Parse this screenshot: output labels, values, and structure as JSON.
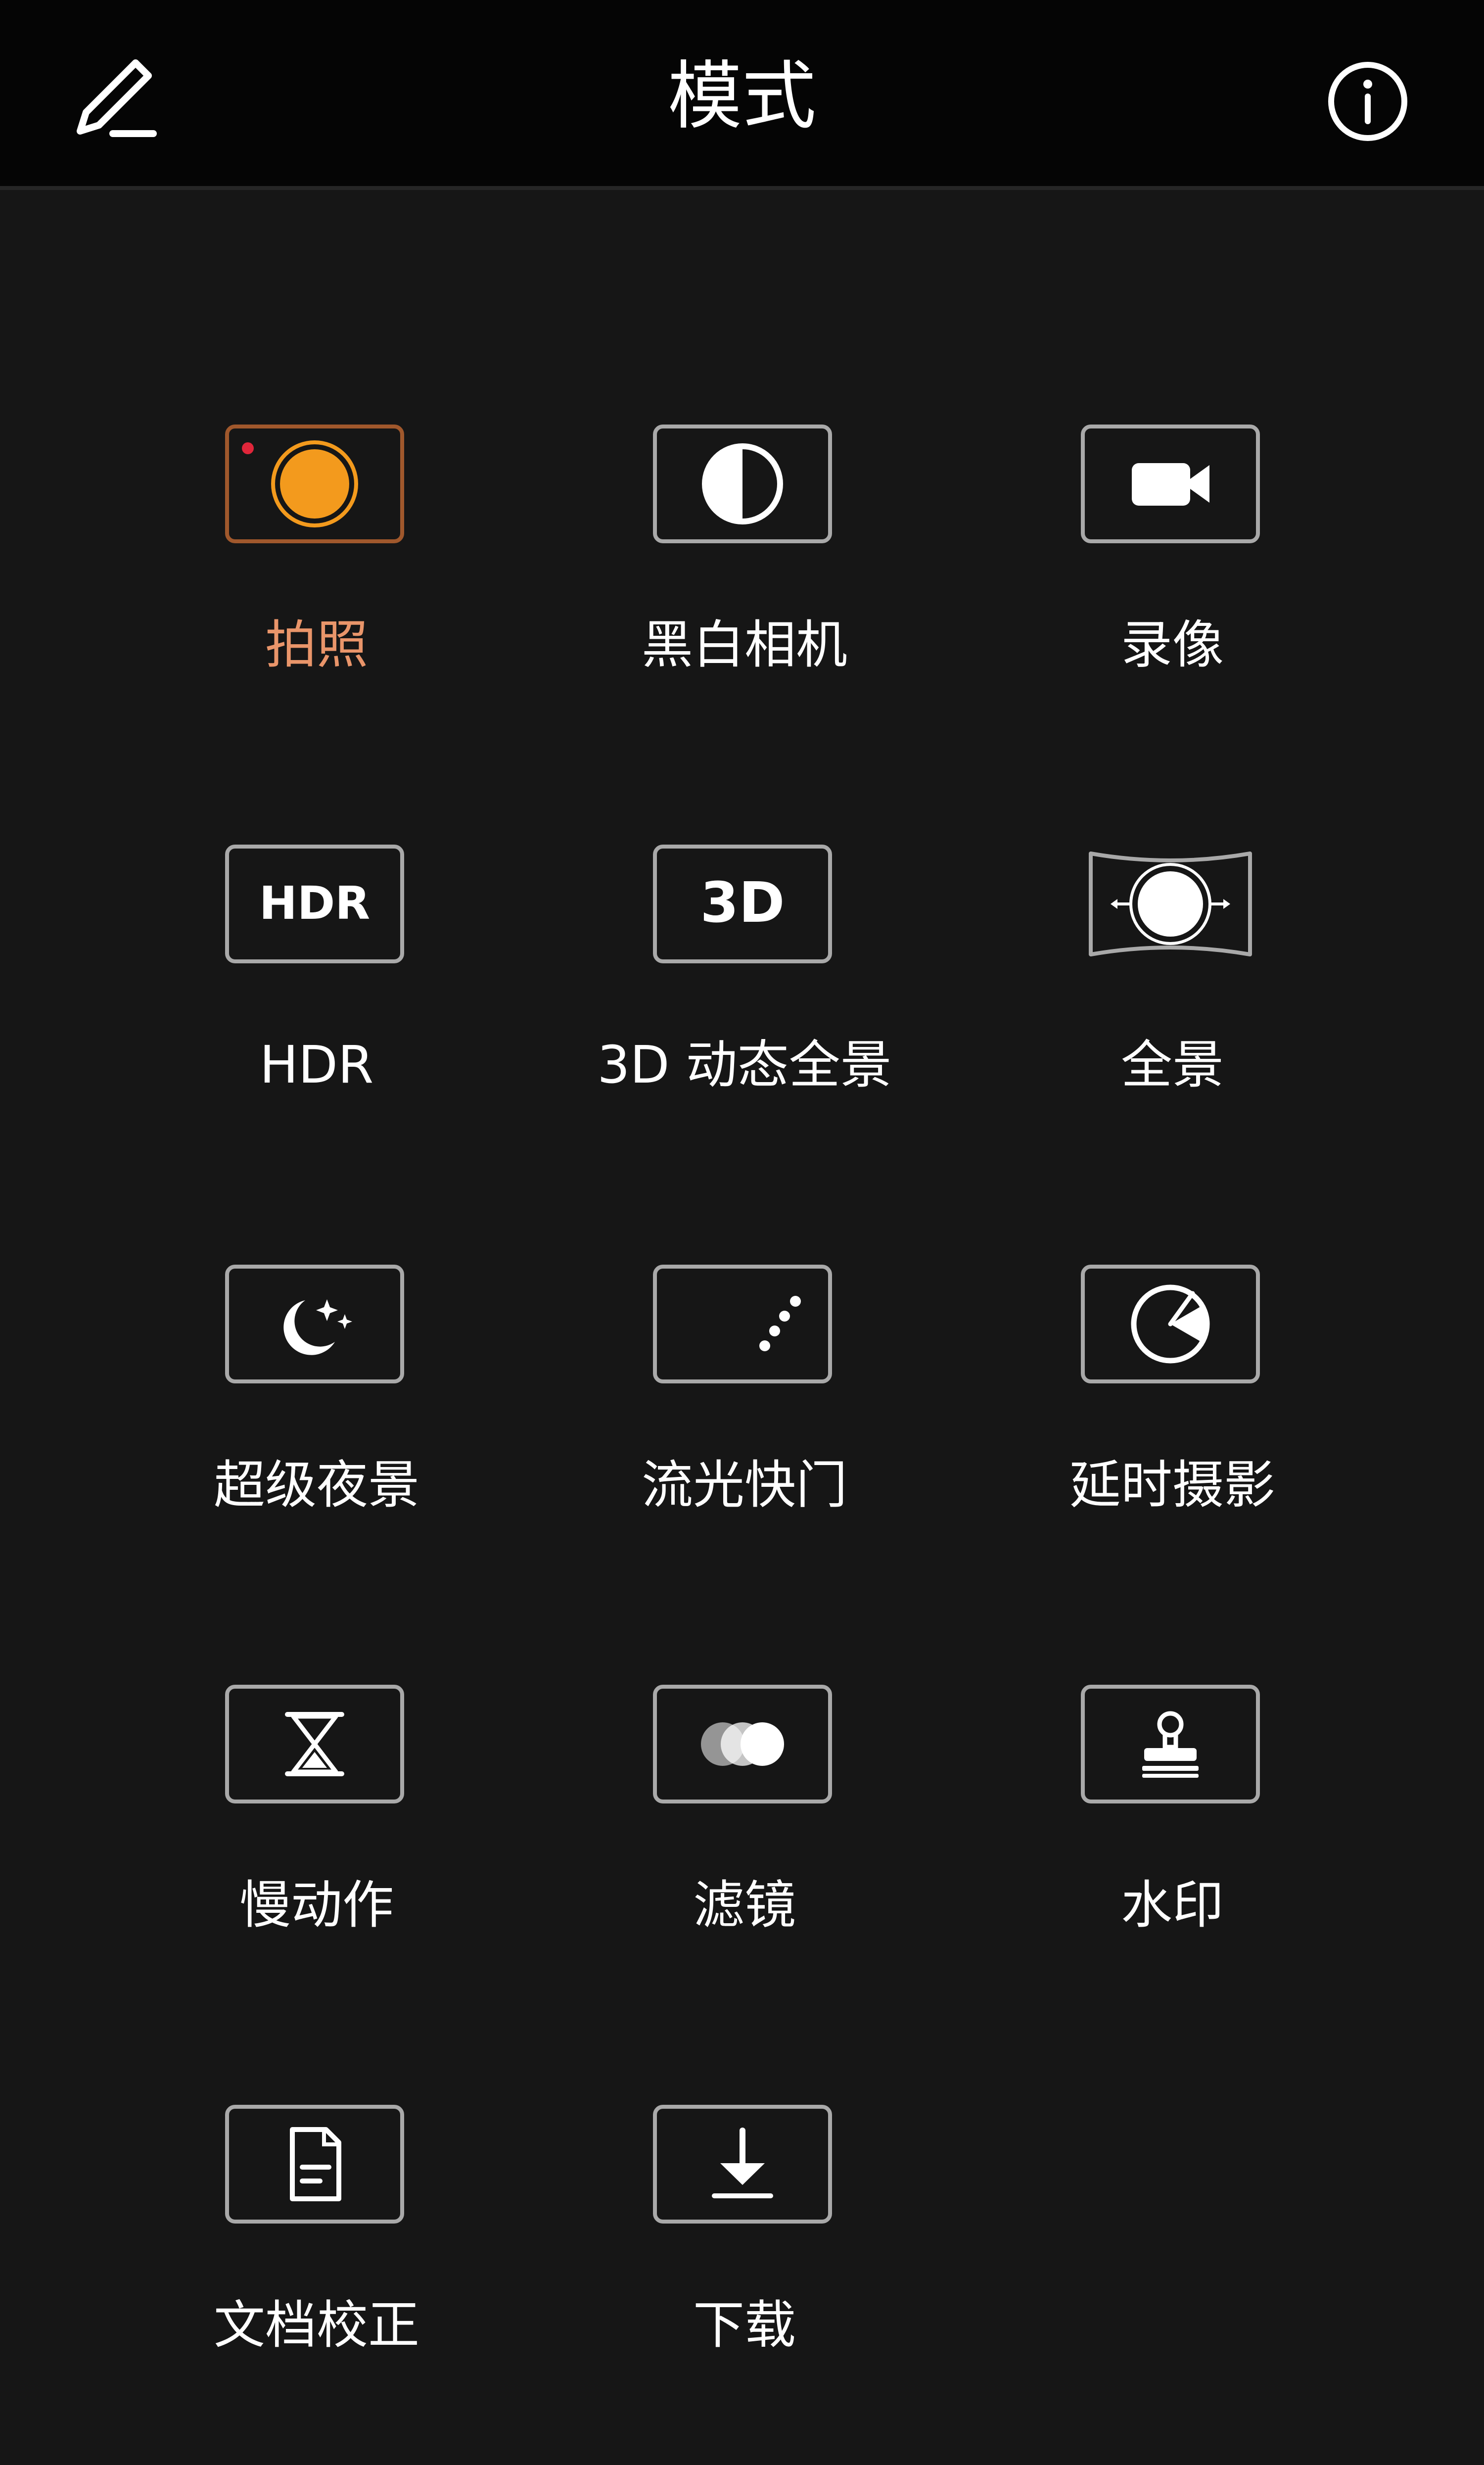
{
  "header": {
    "title": "模式",
    "edit_icon": "edit-pencil-icon",
    "info_icon": "info-circle-icon"
  },
  "accent_color": "#f39a1d",
  "active_label_color": "#e9956a",
  "modes": [
    {
      "label": "拍照",
      "icon": "camera-shutter-icon",
      "selected": true
    },
    {
      "label": "黑白相机",
      "icon": "half-circle-icon",
      "selected": false
    },
    {
      "label": "录像",
      "icon": "video-camera-icon",
      "selected": false
    },
    {
      "label": "HDR",
      "icon": "hdr-text-icon",
      "icon_text": "HDR",
      "selected": false
    },
    {
      "label": "3D 动态全景",
      "icon": "3d-text-icon",
      "icon_text": "3D",
      "selected": false
    },
    {
      "label": "全景",
      "icon": "panorama-icon",
      "selected": false
    },
    {
      "label": "超级夜景",
      "icon": "moon-stars-icon",
      "selected": false
    },
    {
      "label": "流光快门",
      "icon": "light-trails-icon",
      "selected": false
    },
    {
      "label": "延时摄影",
      "icon": "timelapse-dial-icon",
      "selected": false
    },
    {
      "label": "慢动作",
      "icon": "hourglass-icon",
      "selected": false
    },
    {
      "label": "滤镜",
      "icon": "filter-circles-icon",
      "selected": false
    },
    {
      "label": "水印",
      "icon": "stamp-icon",
      "selected": false
    },
    {
      "label": "文档校正",
      "icon": "document-icon",
      "selected": false
    },
    {
      "label": "下载",
      "icon": "download-icon",
      "selected": false
    }
  ]
}
